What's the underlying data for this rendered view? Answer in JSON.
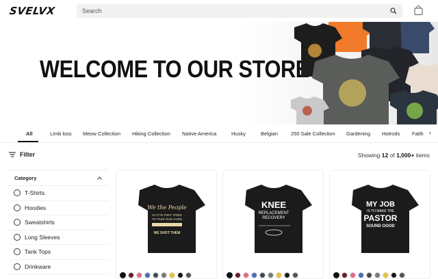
{
  "header": {
    "logo": "SVELVX",
    "search_placeholder": "Search"
  },
  "hero": {
    "title": "WELCOME TO OUR STORE"
  },
  "categories": {
    "tabs": [
      "All",
      "Limb loss",
      "Meow Collection",
      "Hiking Collection",
      "Native America",
      "Husky",
      "Belgian",
      "250 Sale Collection",
      "Gardening",
      "Hotrods",
      "Faith"
    ],
    "active": "All"
  },
  "toolbar": {
    "filter_label": "Filter",
    "showing_prefix": "Showing",
    "showing_count": "12",
    "showing_of": "of",
    "showing_total": "1,000+",
    "showing_suffix": "items"
  },
  "sidebar": {
    "heading": "Category",
    "items": [
      "T-Shirts",
      "Hoodies",
      "Sweatshirts",
      "Long Sleeves",
      "Tank Tops",
      "Drinkware"
    ]
  },
  "products": [
    {
      "shirt_text": [
        "We the People",
        "IN 1776 THEY TRIED",
        "TO TAKE OUR GUNS",
        "WE SHOT THEM"
      ],
      "swatches": [
        "#111111",
        "#6b1f2b",
        "#e06b8b",
        "#4a6fb5",
        "#444a4f",
        "#7a7a7a",
        "#e6c340",
        "#1a1a1a",
        "#555555"
      ]
    },
    {
      "shirt_text": [
        "KNEE",
        "REPLACEMENT",
        "RECOVERY"
      ],
      "swatches": [
        "#111111",
        "#6b1f2b",
        "#e06b8b",
        "#4a6fb5",
        "#444a4f",
        "#7a7a7a",
        "#e6c340",
        "#1a1a1a",
        "#555555"
      ]
    },
    {
      "shirt_text": [
        "MY JOB",
        "IS TO MAKE THE",
        "PASTOR",
        "SOUND GOOD"
      ],
      "swatches": [
        "#111111",
        "#6b1f2b",
        "#e06b8b",
        "#4a6fb5",
        "#444a4f",
        "#7a7a7a",
        "#e6c340",
        "#1a1a1a",
        "#555555"
      ]
    }
  ]
}
